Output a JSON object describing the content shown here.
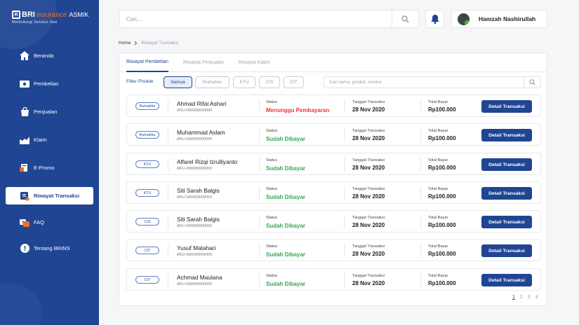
{
  "brand": {
    "mark": "R",
    "bri": "BRI",
    "insurance": "insurance",
    "asmik": "ASMIK",
    "tagline": "Melindungi Setulus Hati"
  },
  "sidebar": {
    "items": [
      {
        "label": "Beranda",
        "icon": "home-icon"
      },
      {
        "label": "Pembelian",
        "icon": "cash-icon"
      },
      {
        "label": "Penjualan",
        "icon": "shopping-bag-icon"
      },
      {
        "label": "Klaim",
        "icon": "claim-icon"
      },
      {
        "label": "E-Promo",
        "icon": "promo-icon"
      },
      {
        "label": "Riwayat Transaksi",
        "icon": "history-icon",
        "active": true
      },
      {
        "label": "FAQ",
        "icon": "faq-icon"
      },
      {
        "label": "Tentang BRINS",
        "icon": "info-icon"
      }
    ]
  },
  "header": {
    "search_placeholder": "Cari...",
    "user_name": "Hamzah Nashirullah"
  },
  "breadcrumb": {
    "home": "Home",
    "current": "Riwayat Transaksi"
  },
  "tabs": [
    "Riwayat Pembelian",
    "Riwayat Penjualan",
    "Riwayat Klaim"
  ],
  "filter": {
    "label": "Filter Produk",
    "chips": [
      "Semua",
      "Rumahku",
      "KTU",
      "CIS",
      "CIT"
    ],
    "search_placeholder": "Cari nama, produk, invoice"
  },
  "labels": {
    "status": "Status",
    "date": "Tanggal Transaksi",
    "total": "Total Bayar",
    "detail": "Detail Transaksi"
  },
  "transactions": [
    {
      "product": "Rumahku",
      "name": "Ahmad Rifai Ashari",
      "code": "RKU-000000000000",
      "status": "Menunggu Pembayaran",
      "paid": false,
      "date": "28 Nov 2020",
      "total": "Rp100.000"
    },
    {
      "product": "Rumahku",
      "name": "Muhammad Aslam",
      "code": "RKU-000000000000",
      "status": "Sudah Dibayar",
      "paid": true,
      "date": "28 Nov 2020",
      "total": "Rp100.000"
    },
    {
      "product": "KTU",
      "name": "Alfarel Rizqi Izrulliyanto",
      "code": "RKU-000000000000",
      "status": "Sudah Dibayar",
      "paid": true,
      "date": "28 Nov 2020",
      "total": "Rp100.000"
    },
    {
      "product": "KTU",
      "name": "Siti Sarah Balgis",
      "code": "RKU-000000000000",
      "status": "Sudah Dibayar",
      "paid": true,
      "date": "28 Nov 2020",
      "total": "Rp100.000"
    },
    {
      "product": "CIS",
      "name": "Siti Sarah Balgis",
      "code": "RKU-000000000000",
      "status": "Sudah Dibayar",
      "paid": true,
      "date": "28 Nov 2020",
      "total": "Rp100.000"
    },
    {
      "product": "CIT",
      "name": "Yusuf Matahari",
      "code": "RKU-000000000000",
      "status": "Sudah Dibayar",
      "paid": true,
      "date": "28 Nov 2020",
      "total": "Rp100.000"
    },
    {
      "product": "CIT",
      "name": "Achmad Maulana",
      "code": "RKU-000000000000",
      "status": "Sudah Dibayar",
      "paid": true,
      "date": "28 Nov 2020",
      "total": "Rp100.000"
    }
  ],
  "pagination": {
    "pages": [
      "1",
      "2",
      "3",
      "4"
    ],
    "current": "1"
  },
  "colors": {
    "primary": "#1f4593",
    "paid": "#34a853",
    "pending": "#e53935",
    "brand_orange": "#f37021"
  }
}
